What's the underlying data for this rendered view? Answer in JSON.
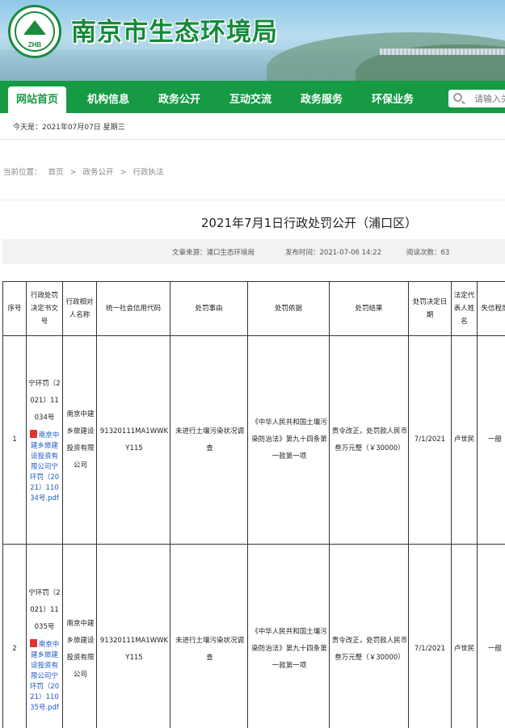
{
  "site": {
    "title": "南京市生态环境局",
    "logo_text": "ZHB"
  },
  "nav": {
    "items": [
      "网站首页",
      "机构信息",
      "政务公开",
      "互动交流",
      "政务服务",
      "环保业务"
    ],
    "search_placeholder": "请输入关"
  },
  "dateline": "今天是：2021年07月07日 星期三",
  "breadcrumb": {
    "label": "当前位置：",
    "items": [
      "首页",
      "政务公开",
      "行政执法"
    ],
    "separator": ">"
  },
  "article": {
    "title": "2021年7月1日行政处罚公开（浦口区）",
    "source": "文章来源：浦口生态环境局",
    "published": "发布时间：2021-07-06 14:22",
    "views": "阅读次数：63"
  },
  "table": {
    "headers": [
      "序号",
      "行政处罚决定书文号",
      "行政相对人名称",
      "统一社会信用代码",
      "处罚事由",
      "处罚依据",
      "处罚结果",
      "处罚决定日期",
      "法定代表人姓名",
      "失信程度"
    ],
    "rows": [
      {
        "no": "1",
        "doc_no": "宁环罚（2021）11034号",
        "file": "南京中建乡旅建设投资有限公司宁环罚（2021）11034号.pdf",
        "party": "南京中建乡旅建设投资有限公司",
        "credit_code": "91320111MA1WWKY115",
        "reason": "未进行土壤污染状况调查",
        "basis": "《中华人民共和国土壤污染防治法》第九十四条第一款第一项",
        "result": "责令改正，处罚款人民币叁万元整（￥30000）",
        "date": "7/1/2021",
        "legal_rep": "卢世民",
        "credit_level": "一般"
      },
      {
        "no": "2",
        "doc_no": "宁环罚（2021）11035号",
        "file": "南京中建乡旅建设投资有限公司宁环罚（2021）11035号.pdf",
        "party": "南京中建乡旅建设投资有限公司",
        "credit_code": "91320111MA1WWKY115",
        "reason": "未进行土壤污染状况调查",
        "basis": "《中华人民共和国土壤污染防治法》第九十四条第一款第一项",
        "result": "责令改正，处罚款人民币叁万元整（￥30000）",
        "date": "7/1/2021",
        "legal_rep": "卢世民",
        "credit_level": "一般"
      }
    ]
  },
  "colors": {
    "brand_green": "#169a43",
    "link_blue": "#1a57c6"
  }
}
